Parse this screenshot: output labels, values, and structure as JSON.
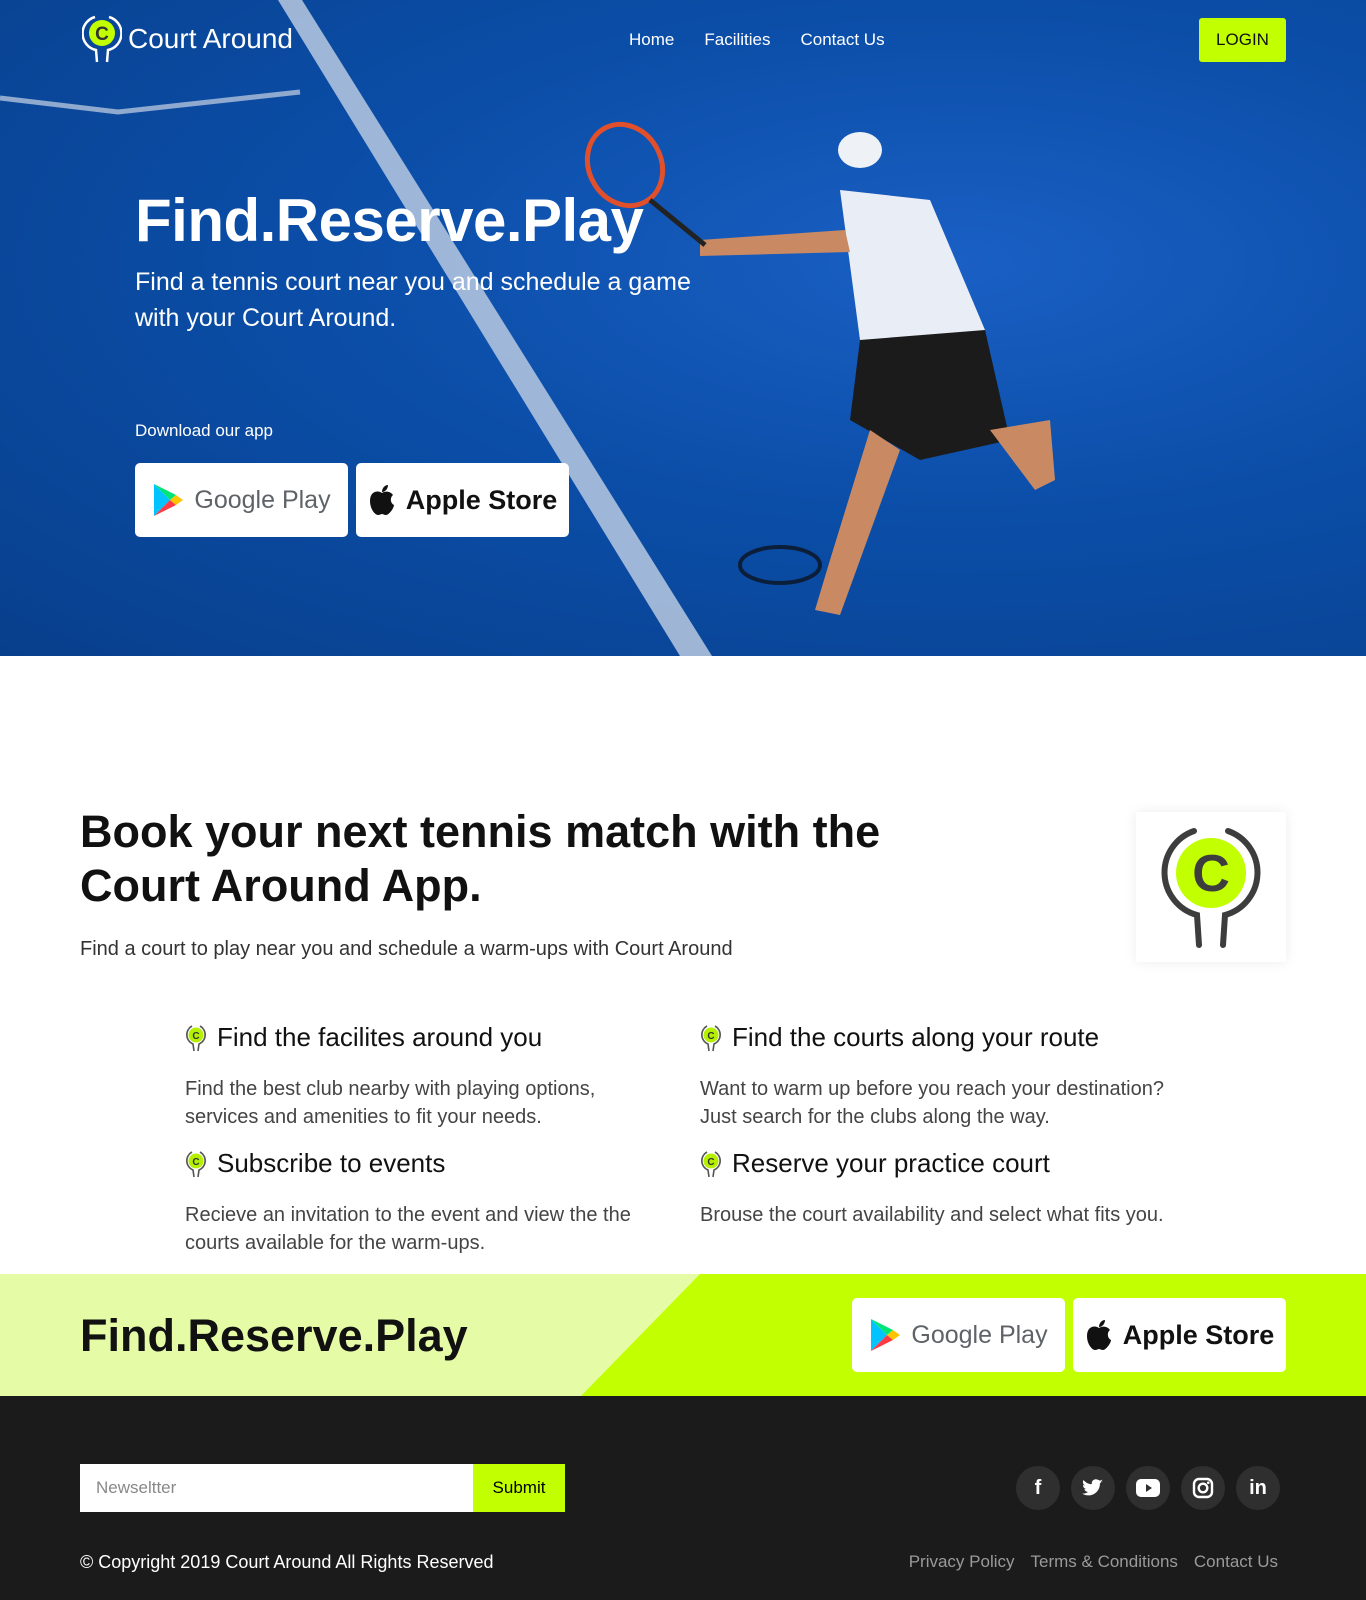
{
  "colors": {
    "accent": "#c2ff00",
    "hero_blue": "#0b4ea8",
    "footer_bg": "#1b1b1b",
    "band_light": "#e6fba6"
  },
  "header": {
    "brand": "Court Around",
    "nav": [
      "Home",
      "Facilities",
      "Contact Us"
    ],
    "login": "LOGIN"
  },
  "hero": {
    "title": "Find.Reserve.Play",
    "subtitle": "Find a tennis court near you and schedule a game with your Court Around.",
    "download_label": "Download our app",
    "google_play": "Google Play",
    "apple_store": "Apple Store"
  },
  "about": {
    "title": "Book your next tennis match with the Court Around App.",
    "subtitle": "Find a court to play near you and schedule a warm-ups with Court Around",
    "features": [
      {
        "title": "Find the facilites around you",
        "desc": "Find the best club nearby with playing options, services and amenities to fit your needs."
      },
      {
        "title": "Find the courts along your route",
        "desc": "Want to warm up before you reach your destination? Just search for the clubs along the way."
      },
      {
        "title": "Subscribe to events",
        "desc": "Recieve an invitation to the event and view the the courts available for the warm-ups."
      },
      {
        "title": "Reserve your practice court",
        "desc": "Brouse the court availability and select what fits you."
      }
    ]
  },
  "band": {
    "title": "Find.Reserve.Play",
    "google_play": "Google Play",
    "apple_store": "Apple Store"
  },
  "footer": {
    "newsletter_placeholder": "Newseltter",
    "submit": "Submit",
    "social": [
      "facebook-icon",
      "twitter-icon",
      "youtube-icon",
      "instagram-icon",
      "linkedin-icon"
    ],
    "copyright": "© Copyright 2019 Court Around All Rights Reserved",
    "links": [
      "Privacy Policy",
      "Terms & Conditions",
      "Contact Us"
    ]
  }
}
